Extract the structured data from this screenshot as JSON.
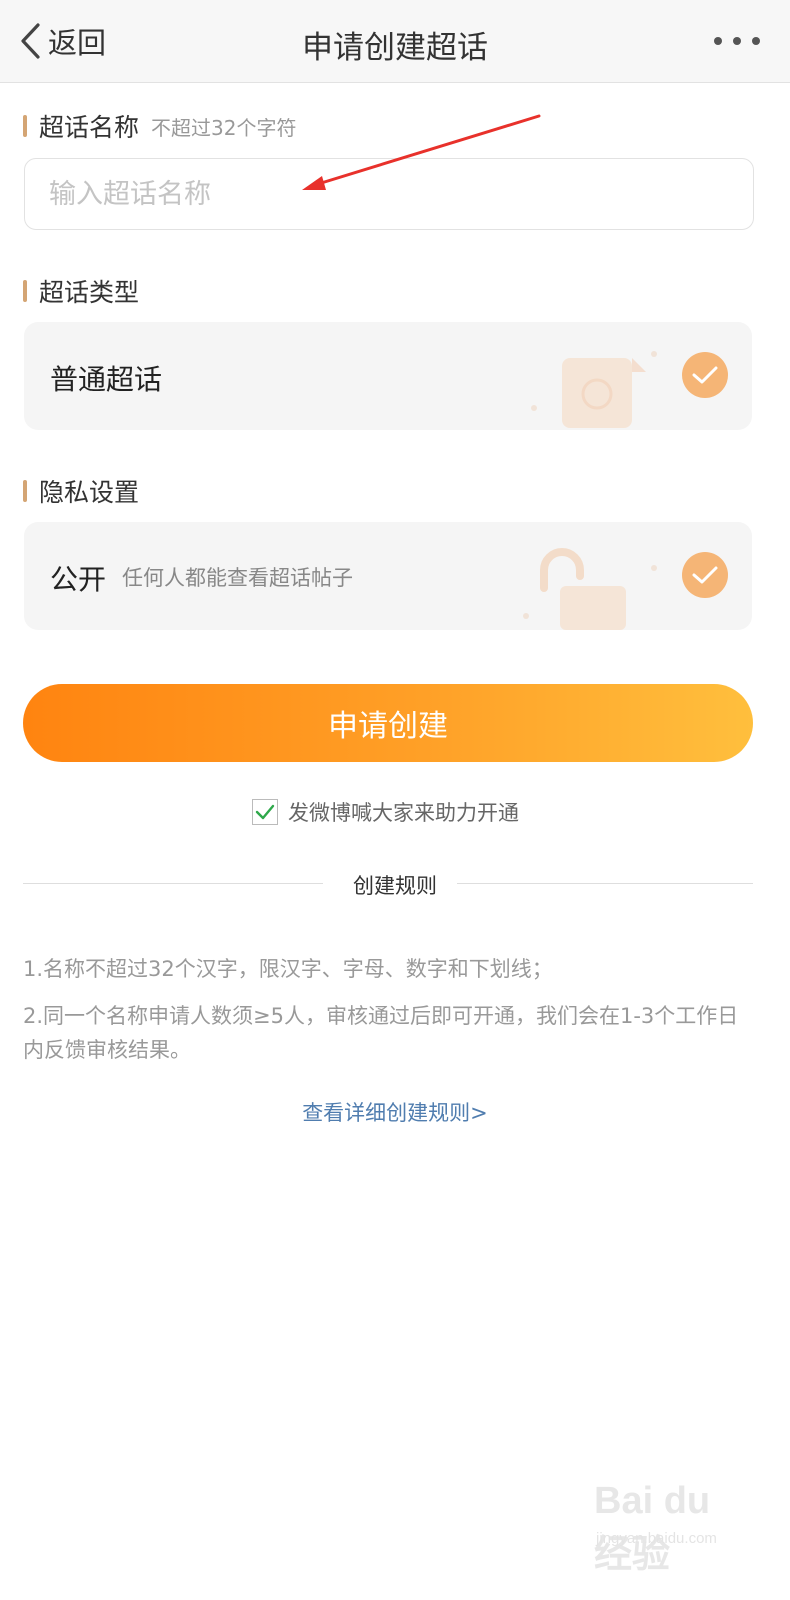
{
  "header": {
    "back_label": "返回",
    "title": "申请创建超话"
  },
  "name_section": {
    "title": "超话名称",
    "hint": "不超过32个字符",
    "placeholder": "输入超话名称"
  },
  "type_section": {
    "title": "超话类型",
    "option": {
      "label": "普通超话",
      "selected": true
    }
  },
  "privacy_section": {
    "title": "隐私设置",
    "option": {
      "label": "公开",
      "description": "任何人都能查看超话帖子",
      "selected": true
    }
  },
  "submit": {
    "label": "申请创建"
  },
  "share": {
    "label": "发微博喊大家来助力开通",
    "checked": true
  },
  "rules": {
    "title": "创建规则",
    "items": [
      "1.名称不超过32个汉字，限汉字、字母、数字和下划线；",
      "2.同一个名称申请人数须≥5人，审核通过后即可开通，我们会在1-3个工作日内反馈审核结果。"
    ],
    "link": "查看详细创建规则>"
  },
  "watermark": {
    "main": "Bai du 经验",
    "sub": "jingyan.baidu.com"
  },
  "colors": {
    "accent": "#d4a574",
    "button_start": "#ff8410",
    "button_end": "#ffbf3d",
    "check": "#f5b576",
    "link": "#507daf",
    "annotation_arrow": "#e8312b"
  },
  "icons": {
    "back": "chevron-left-icon",
    "more": "more-dots-icon",
    "selected": "check-icon",
    "checkbox": "checkbox-checked-icon"
  }
}
